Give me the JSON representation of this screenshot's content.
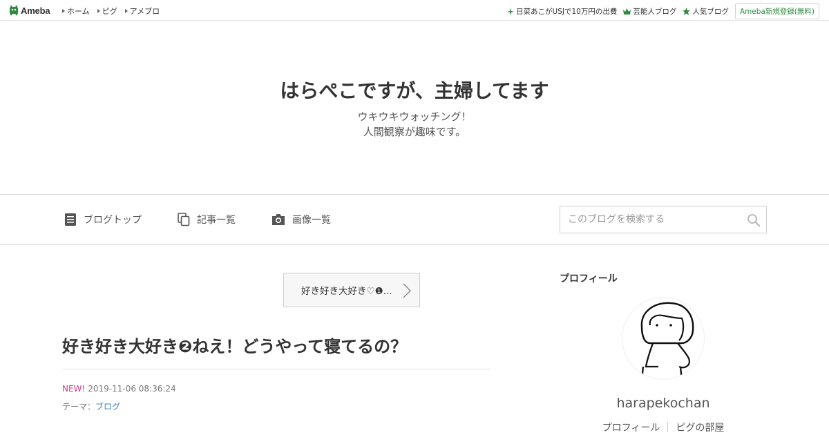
{
  "topbar": {
    "logo_text": "Ameba",
    "nav": [
      "ホーム",
      "ピグ",
      "アメブロ"
    ],
    "right_links": [
      {
        "label": "日菜あこがUSJで10万円の出費",
        "icon": "sparkle-icon"
      },
      {
        "label": "芸能人ブログ",
        "icon": "crown-icon"
      },
      {
        "label": "人気ブログ",
        "icon": "star-icon"
      }
    ],
    "register_label": "Ameba新規登録(無料)"
  },
  "blog": {
    "title": "はらぺこですが、主婦してます",
    "desc_line1": "ウキウキウォッチング！",
    "desc_line2": "人間観察が趣味です。"
  },
  "nav": {
    "links": [
      "ブログトップ",
      "記事一覧",
      "画像一覧"
    ],
    "search_placeholder": "このブログを検索する"
  },
  "entry": {
    "pager_label": "好き好き大好き♡❶...",
    "title": "好き好き大好き❷ねえ！どうやって寝てるの？",
    "new_label": "NEW!",
    "date": "2019-11-06 08:36:24",
    "theme_label": "テーマ：",
    "theme_value": "ブログ"
  },
  "sidebar": {
    "heading": "プロフィール",
    "username": "harapekochan",
    "links": [
      "プロフィール",
      "ピグの部屋"
    ]
  },
  "colors": {
    "brand_green": "#2d8a3e",
    "new_pink": "#d13b8c",
    "link_blue": "#3a7fc1"
  }
}
